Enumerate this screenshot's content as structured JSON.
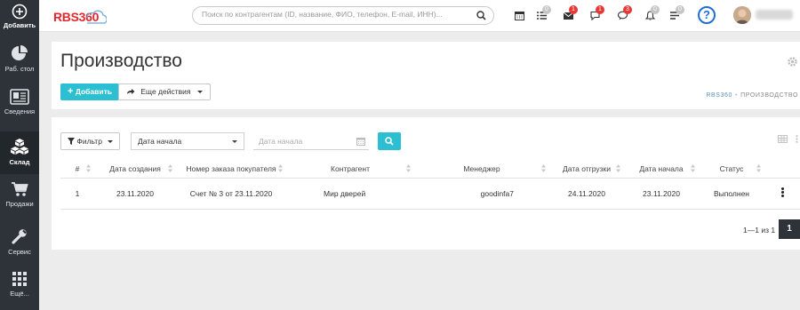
{
  "sidebar": {
    "add_label": "Добавить",
    "items": [
      {
        "label": "Раб. стол",
        "icon": "pie-chart-icon"
      },
      {
        "label": "Сведения",
        "icon": "id-card-icon"
      },
      {
        "label": "Склад",
        "icon": "cubes-icon",
        "active": true
      },
      {
        "label": "Продажи",
        "icon": "cart-icon"
      },
      {
        "label": "Сервис",
        "icon": "wrench-icon"
      },
      {
        "label": "Ещё...",
        "icon": "grid-icon"
      }
    ]
  },
  "topbar": {
    "logo": "RBS360",
    "search_placeholder": "Поиск по контрагентам (ID, название, ФИО, телефон, E-mail, ИНН)...",
    "icons": [
      {
        "name": "calendar-icon",
        "badge": ""
      },
      {
        "name": "list-icon",
        "badge": "0"
      },
      {
        "name": "mail-icon",
        "badge": "1"
      },
      {
        "name": "chat-icon",
        "badge": "1"
      },
      {
        "name": "comments-icon",
        "badge": "3"
      },
      {
        "name": "bell-icon",
        "badge": "0"
      },
      {
        "name": "tasks-icon",
        "badge": "0"
      }
    ],
    "help_label": "?"
  },
  "header": {
    "title": "Производство",
    "add_button": "Добавить",
    "more_button": "Еще действия",
    "breadcrumb": [
      "RBS360",
      "ПРОИЗВОДСТВО"
    ]
  },
  "filters": {
    "filter_button": "Фильтр",
    "date_select": "Дата начала",
    "date_placeholder": "Дата начала"
  },
  "table": {
    "columns": [
      "#",
      "Дата создания",
      "Номер заказа покупателя",
      "Контрагент",
      "Менеджер",
      "Дата отгрузки",
      "Дата начала",
      "Статус",
      ""
    ],
    "rows": [
      [
        "1",
        "23.11.2020",
        "Счет № 3 от 23.11.2020",
        "Мир дверей",
        "goodinfa7",
        "24.11.2020",
        "23.11.2020",
        "Выполнен",
        ""
      ]
    ]
  },
  "pagination": {
    "summary": "1—1 из 1",
    "current_page": "1"
  },
  "colors": {
    "accent": "#2bbfd1",
    "sidebar_bg": "#2d3339",
    "badge_red": "#e53935",
    "logo_red": "#e3262d"
  }
}
